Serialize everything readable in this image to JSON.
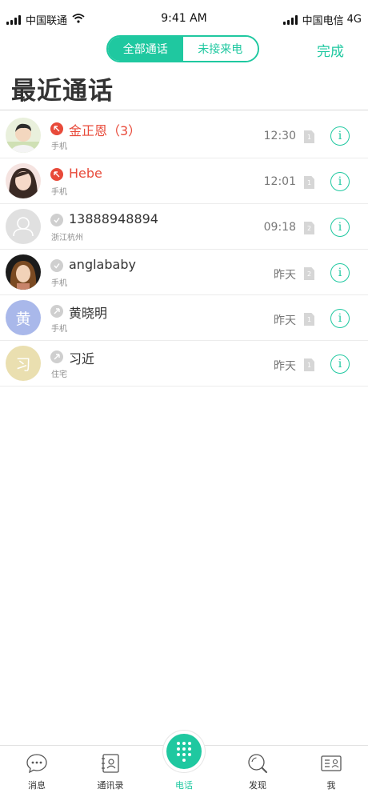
{
  "status_bar": {
    "carrier_left": "中国联通",
    "time": "9:41 AM",
    "carrier_right": "中国电信",
    "network": "4G"
  },
  "header": {
    "tabs": [
      {
        "label": "全部通话",
        "selected": true
      },
      {
        "label": "未接来电",
        "selected": false
      }
    ],
    "done_label": "完成",
    "title": "最近通话"
  },
  "calls": [
    {
      "name": "金正恩（3）",
      "subtitle": "手机",
      "time": "12:30",
      "sim": "1",
      "missed": true,
      "avatar": "photo-man"
    },
    {
      "name": "Hebe",
      "subtitle": "手机",
      "time": "12:01",
      "sim": "1",
      "missed": true,
      "avatar": "photo-woman"
    },
    {
      "name": "13888948894",
      "subtitle": "浙江杭州",
      "time": "09:18",
      "sim": "2",
      "missed": false,
      "avatar": "placeholder"
    },
    {
      "name": "anglababy",
      "subtitle": "手机",
      "time": "昨天",
      "sim": "2",
      "missed": false,
      "avatar": "photo-woman-2"
    },
    {
      "name": "黄晓明",
      "subtitle": "手机",
      "time": "昨天",
      "sim": "1",
      "missed": false,
      "avatar": "letter",
      "avatar_letter": "黄",
      "avatar_color": "#a9b8ea"
    },
    {
      "name": "习近",
      "subtitle": "住宅",
      "time": "昨天",
      "sim": "1",
      "missed": false,
      "avatar": "letter",
      "avatar_letter": "习",
      "avatar_color": "#eadfb0"
    }
  ],
  "tab_bar": {
    "items": [
      {
        "label": "消息",
        "icon": "chat-bubble-icon",
        "active": false
      },
      {
        "label": "通讯录",
        "icon": "contacts-book-icon",
        "active": false
      },
      {
        "label": "电话",
        "icon": "dialpad-icon",
        "active": true
      },
      {
        "label": "发现",
        "icon": "discover-icon",
        "active": false
      },
      {
        "label": "我",
        "icon": "profile-card-icon",
        "active": false
      }
    ]
  },
  "colors": {
    "accent": "#1fc8a0",
    "missed": "#e84a3a"
  }
}
